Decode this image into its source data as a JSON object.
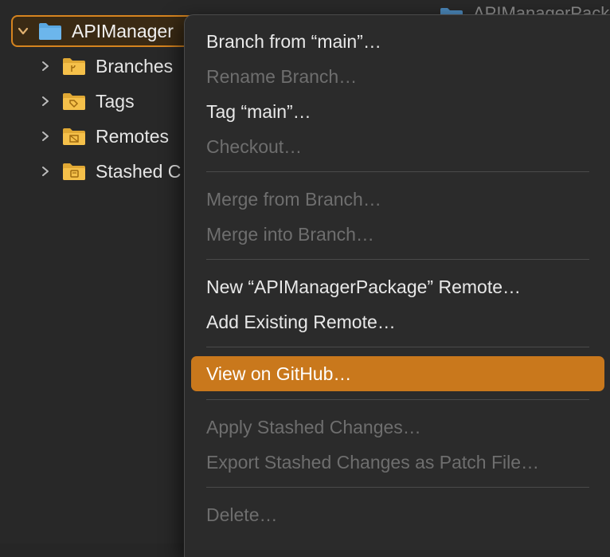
{
  "navigator": {
    "root": {
      "label": "APIManager",
      "expanded": true
    },
    "groups": [
      {
        "label": "Branches",
        "icon": "branch-folder-icon"
      },
      {
        "label": "Tags",
        "icon": "tag-folder-icon"
      },
      {
        "label": "Remotes",
        "icon": "remote-folder-icon"
      },
      {
        "label": "Stashed C",
        "icon": "stash-folder-icon"
      }
    ],
    "partial_top_right": "APIManagerPacka"
  },
  "context_menu": {
    "items": [
      {
        "label": "Branch from “main”…",
        "enabled": true
      },
      {
        "label": "Rename Branch…",
        "enabled": false
      },
      {
        "label": "Tag “main”…",
        "enabled": true
      },
      {
        "label": "Checkout…",
        "enabled": false
      },
      {
        "label": "Merge from Branch…",
        "enabled": false
      },
      {
        "label": "Merge into Branch…",
        "enabled": false
      },
      {
        "label": "New “APIManagerPackage” Remote…",
        "enabled": true
      },
      {
        "label": "Add Existing Remote…",
        "enabled": true
      },
      {
        "label": "View on GitHub…",
        "enabled": true,
        "highlighted": true
      },
      {
        "label": "Apply Stashed Changes…",
        "enabled": false
      },
      {
        "label": "Export Stashed Changes as Patch File…",
        "enabled": false
      },
      {
        "label": "Delete…",
        "enabled": false
      }
    ]
  },
  "colors": {
    "accent": "#c9781c",
    "folder_blue": "#5aa7e0",
    "folder_yellow": "#f5c04a",
    "background": "#282828",
    "menu_background": "#2b2b2b",
    "text": "#e8e8e8",
    "text_disabled": "#6e6e6e"
  }
}
